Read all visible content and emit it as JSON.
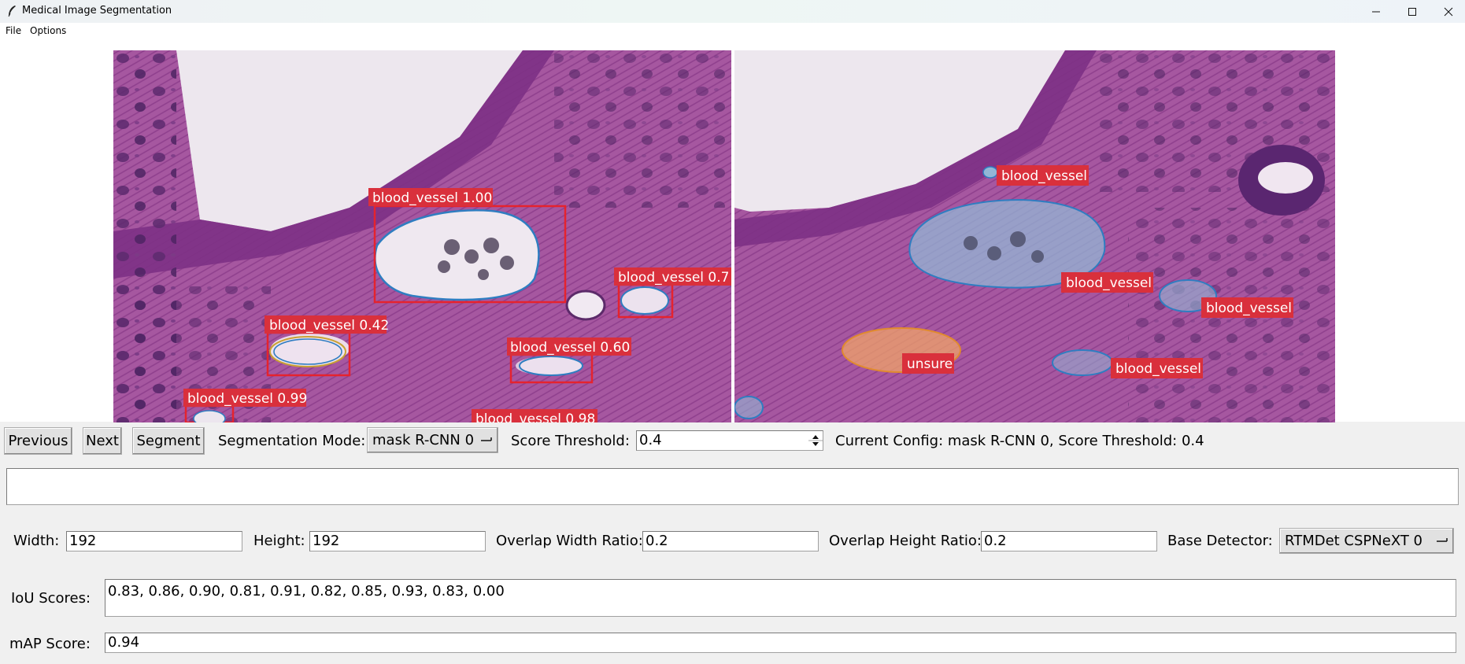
{
  "window": {
    "title": "Medical Image Segmentation",
    "controls": {
      "minimize": "minimize-icon",
      "maximize": "maximize-icon",
      "close": "close-icon"
    }
  },
  "menu": {
    "file": "File",
    "options": "Options"
  },
  "left_image": {
    "detections": [
      {
        "label": "blood_vessel 1.00"
      },
      {
        "label": "blood_vessel 0.7"
      },
      {
        "label": "blood_vessel 0.42"
      },
      {
        "label": "blood_vessel 0.60"
      },
      {
        "label": "blood_vessel 0.99"
      },
      {
        "label": "blood_vessel 0.98"
      }
    ]
  },
  "right_image": {
    "annotations": [
      {
        "label": "blood_vessel"
      },
      {
        "label": "blood_vessel"
      },
      {
        "label": "blood_vessel"
      },
      {
        "label": "unsure"
      },
      {
        "label": "blood_vessel"
      }
    ]
  },
  "controls": {
    "previous": "Previous",
    "next": "Next",
    "segment": "Segment",
    "seg_mode_label": "Segmentation Mode:",
    "seg_mode_value": "mask R-CNN 0",
    "score_threshold_label": "Score Threshold:",
    "score_threshold_value": "0.4",
    "current_config": "Current Config: mask R-CNN 0, Score Threshold: 0.4"
  },
  "status_box": {
    "text": ""
  },
  "params": {
    "width_label": "Width:",
    "width_value": "192",
    "height_label": "Height:",
    "height_value": "192",
    "overlap_w_label": "Overlap Width Ratio:",
    "overlap_w_value": "0.2",
    "overlap_h_label": "Overlap Height Ratio:",
    "overlap_h_value": "0.2",
    "detector_label": "Base Detector:",
    "detector_value": "RTMDet CSPNeXT 0"
  },
  "results": {
    "iou_label": "IoU Scores:",
    "iou_value": "0.83, 0.86, 0.90, 0.81, 0.91, 0.82, 0.85, 0.93, 0.83, 0.00",
    "map_label": "mAP Score:",
    "map_value": "0.94"
  },
  "colors": {
    "tissue": "#a2549c",
    "lumen": "#ece6ec",
    "box": "#e5232e",
    "label_bg": "#d9303c",
    "contour": "#2f7dc1",
    "vessel_fill": "#93b7d6",
    "unsure_fill": "#f0a368"
  }
}
